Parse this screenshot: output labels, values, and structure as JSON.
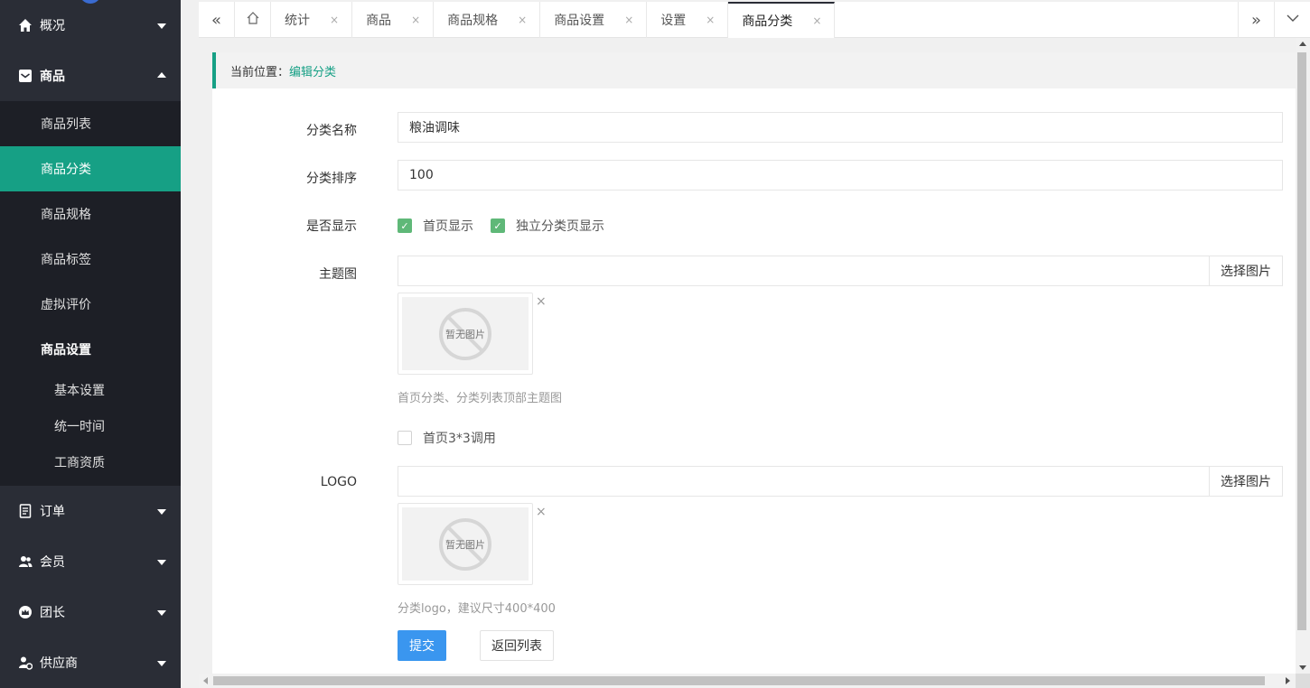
{
  "sidebar": {
    "overview": {
      "label": "概况",
      "icon": "home-icon"
    },
    "goods": {
      "label": "商品",
      "icon": "mail-box-icon"
    },
    "goods_items": [
      {
        "label": "商品列表"
      },
      {
        "label": "商品分类",
        "active": true
      },
      {
        "label": "商品规格"
      },
      {
        "label": "商品标签"
      },
      {
        "label": "虚拟评价"
      }
    ],
    "goods_settings": {
      "label": "商品设置"
    },
    "goods_settings_items": [
      {
        "label": "基本设置"
      },
      {
        "label": "统一时间"
      },
      {
        "label": "工商资质"
      }
    ],
    "orders": {
      "label": "订单",
      "icon": "document-icon"
    },
    "members": {
      "label": "会员",
      "icon": "users-icon"
    },
    "leaders": {
      "label": "团长",
      "icon": "crown-icon"
    },
    "suppliers": {
      "label": "供应商",
      "icon": "supplier-icon"
    }
  },
  "tabs": [
    {
      "label": "统计"
    },
    {
      "label": "商品"
    },
    {
      "label": "商品规格"
    },
    {
      "label": "商品设置"
    },
    {
      "label": "设置"
    },
    {
      "label": "商品分类",
      "active": true
    }
  ],
  "tab_close": "×",
  "breadcrumb": {
    "prefix": "当前位置：",
    "current": "编辑分类"
  },
  "form": {
    "name_label": "分类名称",
    "name_value": "粮油调味",
    "sort_label": "分类排序",
    "sort_value": "100",
    "show_label": "是否显示",
    "show_home": {
      "label": "首页显示",
      "checked": true
    },
    "show_independent": {
      "label": "独立分类页显示",
      "checked": true
    },
    "theme_label": "主题图",
    "theme_value": "",
    "select_image": "选择图片",
    "no_image": "暂无图片",
    "remove": "×",
    "theme_hint": "首页分类、分类列表顶部主题图",
    "home_3x3": {
      "label": "首页3*3调用",
      "checked": false
    },
    "logo_label": "LOGO",
    "logo_value": "",
    "logo_hint": "分类logo，建议尺寸400*400",
    "submit": "提交",
    "back": "返回列表"
  },
  "colors": {
    "accent": "#16a085",
    "primary": "#3a96ef",
    "check": "#5fb878",
    "sidebar": "#2a2d36"
  }
}
